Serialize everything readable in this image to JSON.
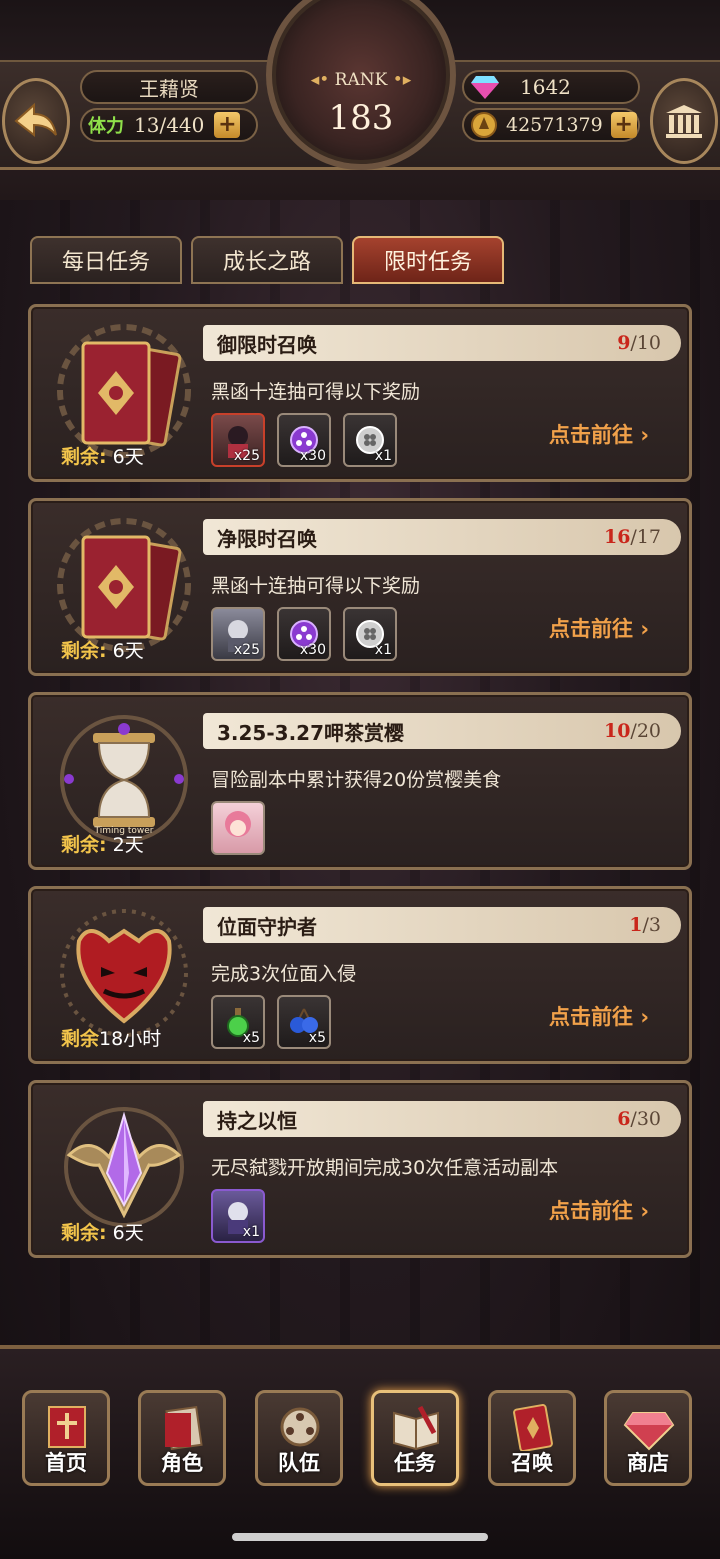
{
  "header": {
    "player_name": "王藉贤",
    "stamina_label": "体力",
    "stamina_value": "13/440",
    "rank_label": "RANK",
    "rank_value": "183",
    "gems": "1642",
    "gold": "42571379"
  },
  "tabs": [
    {
      "label": "每日任务",
      "active": false
    },
    {
      "label": "成长之路",
      "active": false
    },
    {
      "label": "限时任务",
      "active": true
    }
  ],
  "tasks": [
    {
      "title": "御限时召唤",
      "progress_done": "9",
      "progress_total": "/10",
      "description": "黑函十连抽可得以下奖励",
      "remain_label": "剩余:",
      "remain_value": "6天",
      "go_label": "点击前往 ›",
      "rewards": [
        {
          "icon": "character-card-icon",
          "qty": "x25"
        },
        {
          "icon": "purple-orb-icon",
          "qty": "x30"
        },
        {
          "icon": "clover-coin-icon",
          "qty": "x1"
        }
      ]
    },
    {
      "title": "净限时召唤",
      "progress_done": "16",
      "progress_total": "/17",
      "description": "黑函十连抽可得以下奖励",
      "remain_label": "剩余:",
      "remain_value": "6天",
      "go_label": "点击前往 ›",
      "rewards": [
        {
          "icon": "character-card-icon",
          "qty": "x25"
        },
        {
          "icon": "purple-orb-icon",
          "qty": "x30"
        },
        {
          "icon": "clover-coin-icon",
          "qty": "x1"
        }
      ]
    },
    {
      "title": "3.25-3.27呷茶赏樱",
      "progress_done": "10",
      "progress_total": "/20",
      "description": "冒险副本中累计获得20份赏樱美食",
      "remain_label": "剩余:",
      "remain_value": "2天",
      "emblem_text": "Timing tower",
      "go_label": "",
      "rewards": [
        {
          "icon": "character-portrait-icon",
          "qty": ""
        }
      ]
    },
    {
      "title": "位面守护者",
      "progress_done": "1",
      "progress_total": "/3",
      "description": "完成3次位面入侵",
      "remain_label": "剩余",
      "remain_value": "18小时",
      "go_label": "点击前往 ›",
      "rewards": [
        {
          "icon": "green-potion-icon",
          "qty": "x5"
        },
        {
          "icon": "blue-berry-icon",
          "qty": "x5"
        }
      ]
    },
    {
      "title": "持之以恒",
      "progress_done": "6",
      "progress_total": "/30",
      "description": "无尽弑戮开放期间完成30次任意活动副本",
      "remain_label": "剩余:",
      "remain_value": "6天",
      "go_label": "点击前往 ›",
      "rewards": [
        {
          "icon": "character-card-icon",
          "qty": "x1"
        }
      ]
    }
  ],
  "nav": [
    {
      "label": "首页",
      "icon": "home-icon"
    },
    {
      "label": "角色",
      "icon": "character-icon"
    },
    {
      "label": "队伍",
      "icon": "team-icon"
    },
    {
      "label": "任务",
      "icon": "quest-book-icon",
      "active": true
    },
    {
      "label": "召唤",
      "icon": "summon-card-icon"
    },
    {
      "label": "商店",
      "icon": "shop-gem-icon"
    }
  ]
}
